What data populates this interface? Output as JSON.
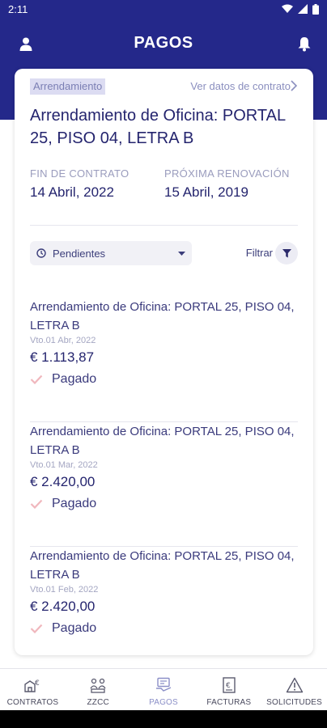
{
  "status_bar": {
    "time": "2:11"
  },
  "header": {
    "title": "PAGOS"
  },
  "contract": {
    "type_chip": "Arrendamiento",
    "view_link": "Ver datos de contrato",
    "title": "Arrendamiento de Oficina: PORTAL 25, PISO 04, LETRA B",
    "end_label": "FIN DE CONTRATO",
    "end_date": "14 Abril, 2022",
    "renewal_label": "PRÓXIMA RENOVACIÓN",
    "renewal_date": "15 Abril, 2019"
  },
  "filter": {
    "selected": "Pendientes",
    "filter_label": "Filtrar"
  },
  "payments": [
    {
      "title": "Arrendamiento de Oficina: PORTAL 25, PISO 04, LETRA B",
      "due": "Vto.01 Abr, 2022",
      "amount": "€ 1.113,87",
      "status": "Pagado"
    },
    {
      "title": "Arrendamiento de Oficina: PORTAL 25, PISO 04, LETRA B",
      "due": "Vto.01 Mar, 2022",
      "amount": "€ 2.420,00",
      "status": "Pagado"
    },
    {
      "title": "Arrendamiento de Oficina: PORTAL 25, PISO 04, LETRA B",
      "due": "Vto.01 Feb, 2022",
      "amount": "€ 2.420,00",
      "status": "Pagado"
    }
  ],
  "bottom_nav": {
    "items": [
      {
        "label": "CONTRATOS",
        "icon": "contracts-icon",
        "active": false
      },
      {
        "label": "ZZCC",
        "icon": "community-icon",
        "active": false
      },
      {
        "label": "PAGOS",
        "icon": "payments-icon",
        "active": true
      },
      {
        "label": "FACTURAS",
        "icon": "invoices-icon",
        "active": false
      },
      {
        "label": "SOLICITUDES",
        "icon": "warning-icon",
        "active": false
      }
    ]
  },
  "colors": {
    "brand": "#24288a",
    "text_dark": "#24246e",
    "check": "#f0b7bd",
    "active_nav": "#8b8fc7"
  }
}
